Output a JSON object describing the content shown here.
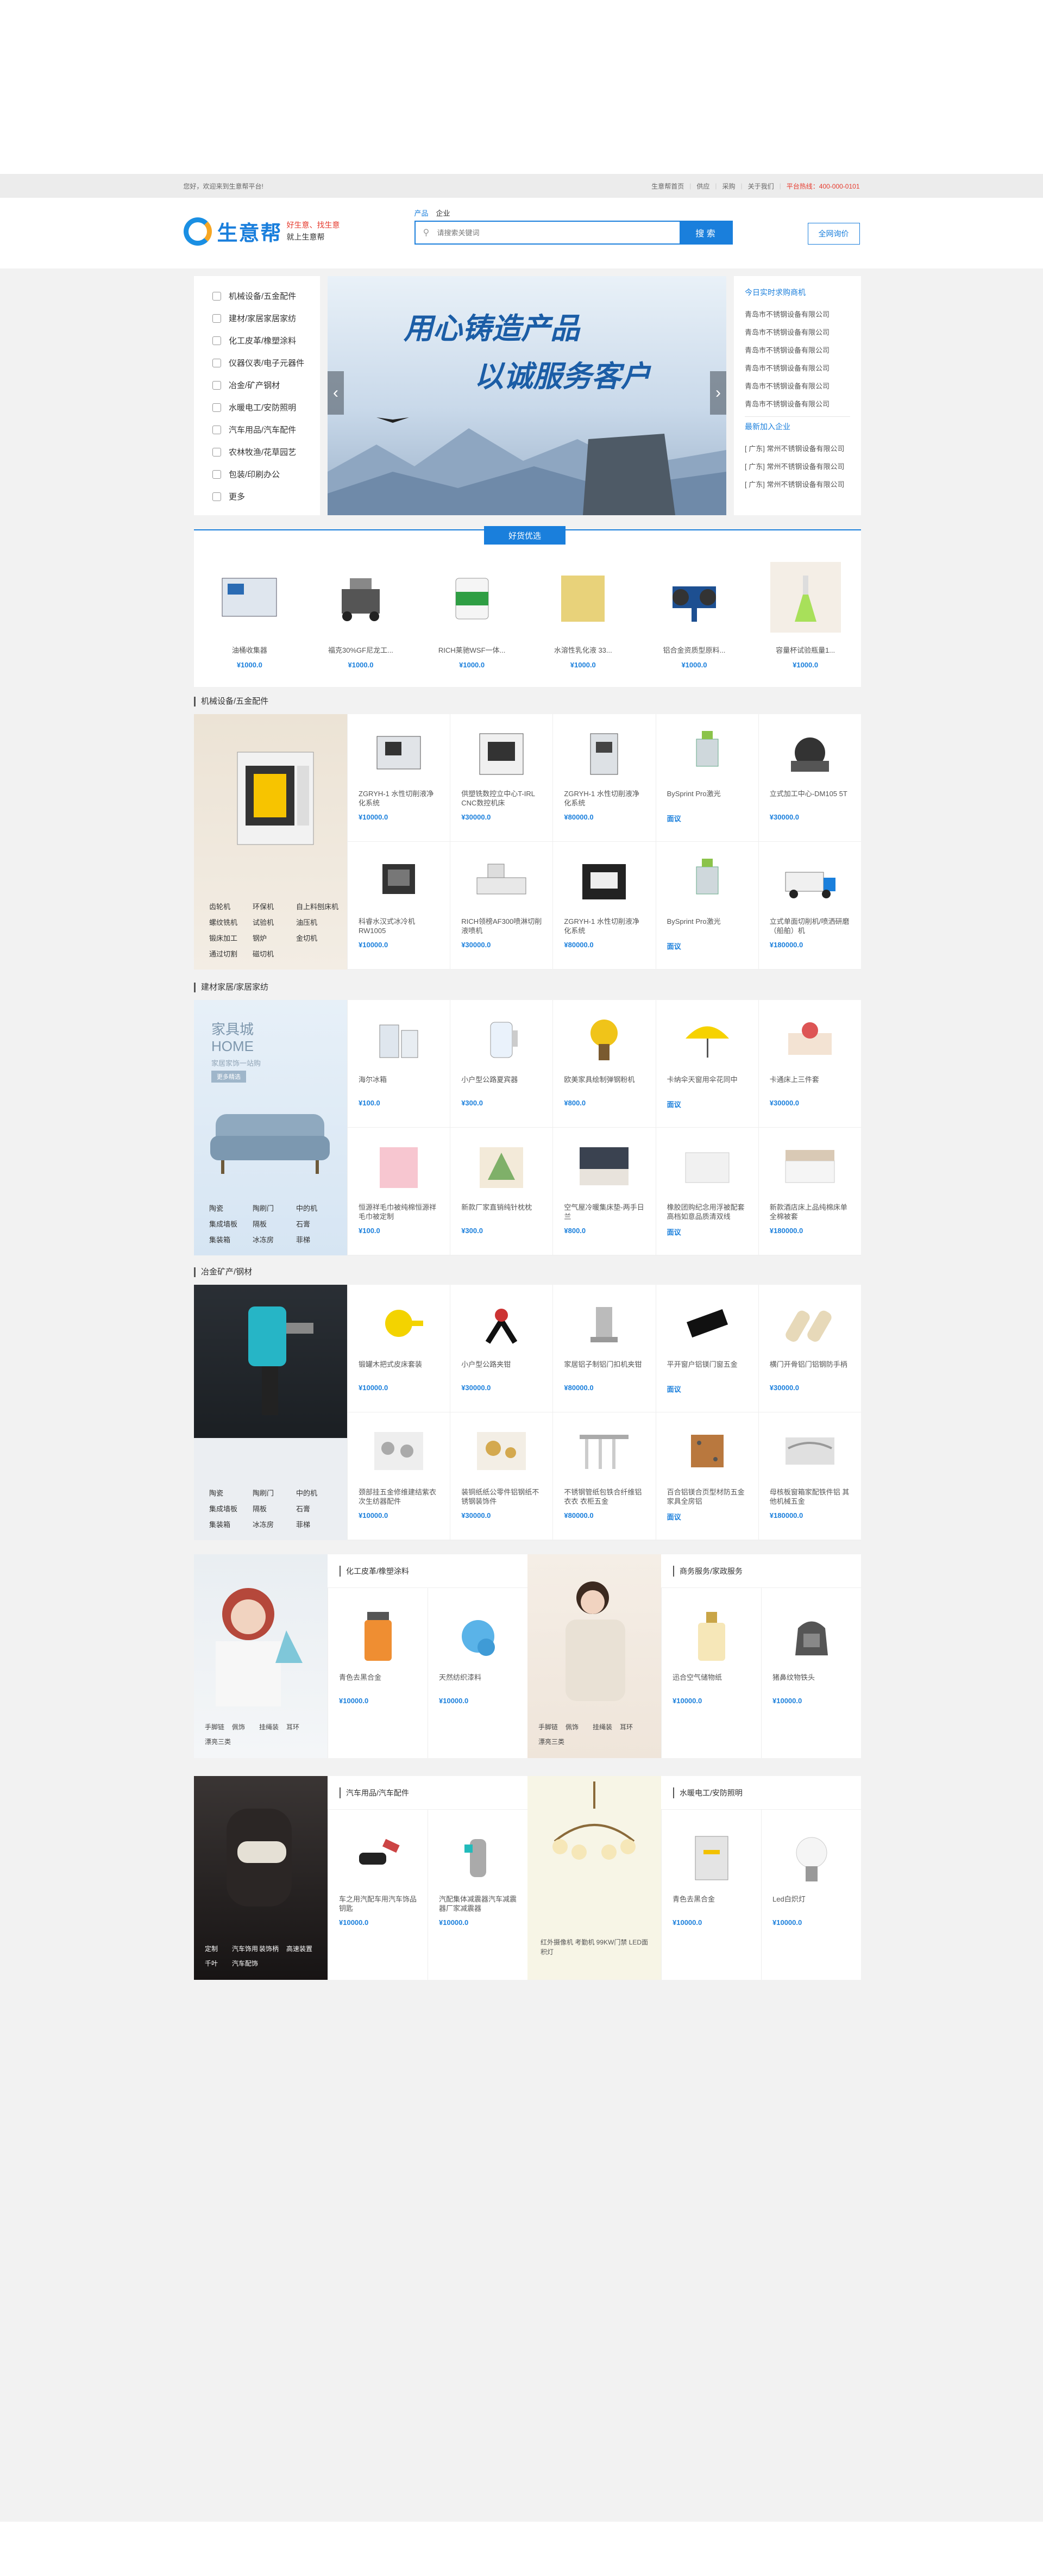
{
  "topbar": {
    "welcome": "您好，欢迎来到生意帮平台!",
    "links": [
      "生意帮首页",
      "供应",
      "采购",
      "关于我们"
    ],
    "hotline": "平台热线：400-000-0101"
  },
  "header": {
    "logo": "生意帮",
    "slogan1": "好生意、找生意",
    "slogan2": "就上生意帮",
    "tabs": [
      "产品",
      "企业"
    ],
    "search_placeholder": "请搜索关键词",
    "search_btn": "搜 索",
    "quote_btn": "全网询价"
  },
  "nav": [
    "机械设备/五金配件",
    "建材/家居家居家纺",
    "化工皮革/橡塑涂料",
    "仪器仪表/电子元器件",
    "冶金/矿产钢材",
    "水暖电工/安防照明",
    "汽车用品/汽车配件",
    "农林牧渔/花草园艺",
    "包装/印刷办公",
    "更多"
  ],
  "banner": {
    "line1": "用心铸造产品",
    "line2": "以诚服务客户"
  },
  "side": {
    "title1": "今日实时求购商机",
    "list1": [
      "青岛市不锈钢设备有限公司",
      "青岛市不锈钢设备有限公司",
      "青岛市不锈钢设备有限公司",
      "青岛市不锈钢设备有限公司",
      "青岛市不锈钢设备有限公司",
      "青岛市不锈钢设备有限公司"
    ],
    "title2": "最新加入企业",
    "list2": [
      "[ 广东] 常州不锈钢设备有限公司",
      "[ 广东] 常州不锈钢设备有限公司",
      "[ 广东] 常州不锈钢设备有限公司"
    ]
  },
  "goods": {
    "tag": "好货优选",
    "items": [
      {
        "name": "油桶收集器",
        "price": "¥1000.0"
      },
      {
        "name": "福克30%GF尼龙工...",
        "price": "¥1000.0"
      },
      {
        "name": "RICH莱驰WSF一体...",
        "price": "¥1000.0"
      },
      {
        "name": "水溶性乳化液 33...",
        "price": "¥1000.0"
      },
      {
        "name": "铝合金资质型原料...",
        "price": "¥1000.0"
      },
      {
        "name": "容量杯试验瓶量1...",
        "price": "¥1000.0"
      }
    ]
  },
  "floor1": {
    "title": "机械设备/五金配件",
    "cats": [
      "齿轮机",
      "环保机",
      "自上料刨床机",
      "螺纹铣机",
      "试验机",
      "油压机",
      "锻床加工",
      "钢炉",
      "金切机",
      "通过切割",
      "磁切机"
    ],
    "items": [
      {
        "name": "ZGRYH-1 水性切削液净化系统",
        "price": "¥10000.0"
      },
      {
        "name": "供塑铣数控立中心T-IRL CNC数控机床",
        "price": "¥30000.0"
      },
      {
        "name": "ZGRYH-1 水性切削液净化系统",
        "price": "¥80000.0"
      },
      {
        "name": "BySprint Pro激光",
        "price": "面议"
      },
      {
        "name": "立式加工中心-DM105 5T",
        "price": "¥30000.0"
      },
      {
        "name": "科睿水汉式冰冷机 RW1005",
        "price": "¥10000.0"
      },
      {
        "name": "RICH领榜AF300喷淋切削液喷机",
        "price": "¥30000.0"
      },
      {
        "name": "ZGRYH-1 水性切削液净化系统",
        "price": "¥80000.0"
      },
      {
        "name": "BySprint Pro激光",
        "price": "面议"
      },
      {
        "name": "立式单面切削机/喷洒研磨（船舶）机",
        "price": "¥180000.0"
      }
    ]
  },
  "floor2": {
    "title": "建材家居/家居家纺",
    "banner1": "家具城",
    "banner2": "HOME",
    "banner3": "家居家饰一站购",
    "banner_btn": "更多精选",
    "cats": [
      "陶瓷",
      "陶刷门",
      "中的机",
      "集成墙板",
      "隔板",
      "石膏",
      "集装箱",
      "冰冻房",
      "菲梯"
    ],
    "items": [
      {
        "name": "海尔冰箱",
        "price": "¥100.0"
      },
      {
        "name": "小户型公路夏宾器",
        "price": "¥300.0"
      },
      {
        "name": "欧美家具绘制弹钢粉机",
        "price": "¥800.0"
      },
      {
        "name": "卡纳伞天窗用伞花同中",
        "price": "面议"
      },
      {
        "name": "卡通床上三件套",
        "price": "¥30000.0"
      },
      {
        "name": "恒源祥毛巾被纯棉恒源祥毛巾被定制",
        "price": "¥100.0"
      },
      {
        "name": "新款厂家直销纯针枕枕",
        "price": "¥300.0"
      },
      {
        "name": "空气屋冷暖集床垫-两手日兰",
        "price": "¥800.0"
      },
      {
        "name": "橡胶团购纪念用浮被配套高档如意品质清双线",
        "price": "面议"
      },
      {
        "name": "新款酒店床上品纯棉床单全棉被套",
        "price": "¥180000.0"
      }
    ]
  },
  "floor3": {
    "title": "冶金矿产/钢材",
    "cats": [
      "陶瓷",
      "陶刷门",
      "中的机",
      "集成墙板",
      "隔板",
      "石膏",
      "集装箱",
      "冰冻房",
      "菲梯"
    ],
    "items": [
      {
        "name": "锻罐木把式皮床套装",
        "price": "¥10000.0"
      },
      {
        "name": "小户型公路夹钳",
        "price": "¥30000.0"
      },
      {
        "name": "家居铝子制铝门扣机夹钳",
        "price": "¥80000.0"
      },
      {
        "name": "平开窗户铝镁门窗五金",
        "price": "面议"
      },
      {
        "name": "横门开骨铝门铝钢防手柄",
        "price": "¥30000.0"
      },
      {
        "name": "颈部挂五金修维建结紫衣次生纺器配件",
        "price": "¥10000.0"
      },
      {
        "name": "装铜纸纸公零件铝钢纸不锈钢装饰件",
        "price": "¥30000.0"
      },
      {
        "name": "不锈钢管纸包铁合纤维铝衣衣 衣柜五金",
        "price": "¥80000.0"
      },
      {
        "name": "百合铝镁合页型材防五金家具全房铝",
        "price": "面议"
      },
      {
        "name": "母核板窗箱家配铁件铝 其他机械五金",
        "price": "¥180000.0"
      }
    ]
  },
  "half1": {
    "title": "化工皮革/橡塑涂料",
    "cats": [
      "手脚链",
      "佩饰",
      "挂绳装",
      "耳环",
      "漂亮三类"
    ],
    "items": [
      {
        "name": "青色去黑合金",
        "price": "¥10000.0"
      },
      {
        "name": "天然纺织漆料",
        "price": "¥10000.0"
      }
    ]
  },
  "half2": {
    "title": "商务服务/家政服务",
    "cats": [
      "手脚链",
      "佩饰",
      "挂绳装",
      "耳环",
      "漂亮三类"
    ],
    "items": [
      {
        "name": "迅合空气储物纸",
        "price": "¥10000.0"
      },
      {
        "name": "猪鼻纹物铁头",
        "price": "¥10000.0"
      }
    ]
  },
  "half3": {
    "title": "汽车用品/汽车配件",
    "cats": [
      "定制",
      "汽车饰用",
      "装饰柄",
      "高速装置",
      "千叶",
      "汽车配饰"
    ],
    "items": [
      {
        "name": "车之用汽配车用汽车饰品钥匙",
        "price": "¥10000.0"
      },
      {
        "name": "汽配集体减震器汽车减震器厂家减震器",
        "price": "¥10000.0"
      }
    ]
  },
  "half4": {
    "title": "水暖电工/安防照明",
    "note": "红外摄像机 考勤机 99KW门禁 LED面积灯",
    "items": [
      {
        "name": "青色去黑合金",
        "price": "¥10000.0"
      },
      {
        "name": "Led白炽灯",
        "price": "¥10000.0"
      }
    ]
  }
}
